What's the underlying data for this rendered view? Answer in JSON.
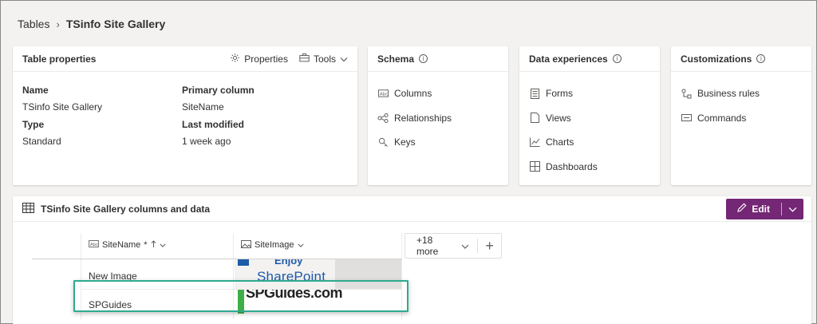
{
  "breadcrumb": {
    "root": "Tables",
    "current": "TSinfo Site Gallery"
  },
  "table_properties": {
    "title": "Table properties",
    "properties_label": "Properties",
    "tools_label": "Tools",
    "name_label": "Name",
    "name_value": "TSinfo Site Gallery",
    "type_label": "Type",
    "type_value": "Standard",
    "primary_column_label": "Primary column",
    "primary_column_value": "SiteName",
    "last_modified_label": "Last modified",
    "last_modified_value": "1 week ago"
  },
  "schema": {
    "title": "Schema",
    "items": [
      "Columns",
      "Relationships",
      "Keys"
    ]
  },
  "data_experiences": {
    "title": "Data experiences",
    "items": [
      "Forms",
      "Views",
      "Charts",
      "Dashboards"
    ]
  },
  "customizations": {
    "title": "Customizations",
    "items": [
      "Business rules",
      "Commands"
    ]
  },
  "data_section": {
    "title": "TSinfo Site Gallery columns and data",
    "edit_label": "Edit",
    "columns": [
      "SiteName",
      "SiteImage"
    ],
    "required_marker": "*",
    "more_label": "+18 more",
    "rows": [
      {
        "site_name": "New Image",
        "image_text_top": "Enjoy",
        "image_text": "SharePoint"
      },
      {
        "site_name": "SPGuides",
        "image_text": "SPGuides.com"
      }
    ]
  },
  "colors": {
    "accent": "#742774",
    "selection": "#2eaa8f",
    "background": "#f3f2f1"
  },
  "icons": [
    "chevron-right-icon",
    "gear-icon",
    "toolbox-icon",
    "chevron-down-icon",
    "info-icon",
    "text-column-icon",
    "relationship-icon",
    "key-icon",
    "form-icon",
    "view-icon",
    "chart-icon",
    "dashboard-icon",
    "business-rule-icon",
    "command-icon",
    "table-grid-icon",
    "pencil-icon",
    "sort-up-icon",
    "image-column-icon",
    "plus-icon"
  ]
}
